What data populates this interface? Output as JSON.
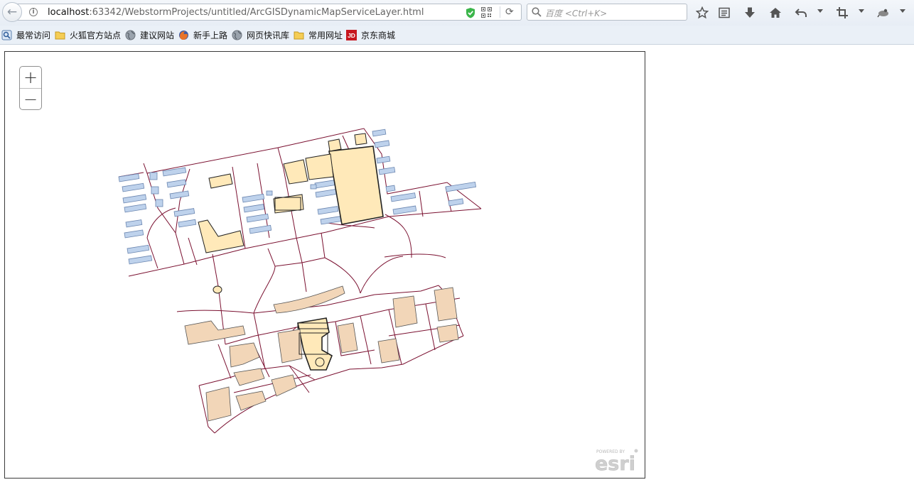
{
  "browser": {
    "url_host": "localhost",
    "url_rest": ":63342/WebstormProjects/untitled/ArcGISDynamicMapServiceLayer.html",
    "search_placeholder": "百度 <Ctrl+K>",
    "toolbar_icons": [
      "bookmark-star-icon",
      "reading-list-icon",
      "download-icon",
      "home-icon",
      "undo-icon",
      "screenshot-crop-icon",
      "extension-icon"
    ]
  },
  "bookmarks": [
    {
      "label": "最常访问",
      "icon": "frequent-icon"
    },
    {
      "label": "火狐官方站点",
      "icon": "folder-icon"
    },
    {
      "label": "建议网站",
      "icon": "globe-icon"
    },
    {
      "label": "新手上路",
      "icon": "firefox-icon"
    },
    {
      "label": "网页快讯库",
      "icon": "globe-icon"
    },
    {
      "label": "常用网址",
      "icon": "folder-icon"
    },
    {
      "label": "京东商城",
      "icon": "jd-icon"
    }
  ],
  "map": {
    "zoom_in_label": "+",
    "zoom_out_label": "−",
    "attribution_small": "POWERED BY",
    "attribution_logo": "esri",
    "colors": {
      "road_line": "#7a1030",
      "building_blue_fill": "#bed2ec",
      "building_blue_stroke": "#6b86b0",
      "building_yellow_fill": "#ffe9b9",
      "building_tan_fill": "#f2d6b8",
      "building_outline": "#222222"
    }
  }
}
